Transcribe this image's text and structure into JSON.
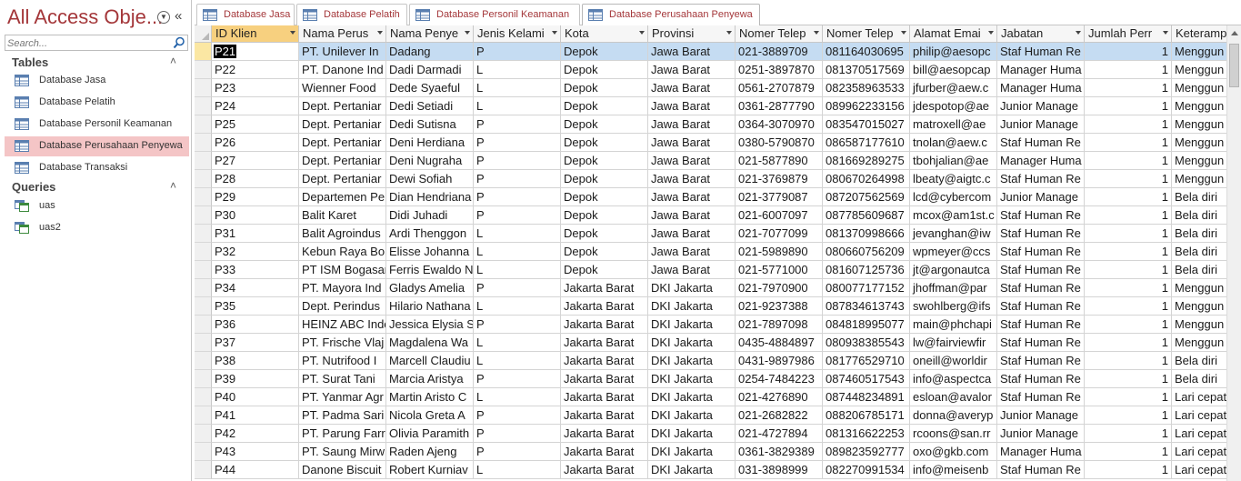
{
  "nav": {
    "title": "All Access Obje...",
    "search_placeholder": "Search...",
    "groups": [
      {
        "label": "Tables",
        "caret": "˄"
      },
      {
        "label": "Queries",
        "caret": "˄"
      }
    ],
    "tables": [
      "Database Jasa",
      "Database Pelatih",
      "Database Personil Keamanan",
      "Database Perusahaan Penyewa",
      "Database Transaksi"
    ],
    "queries": [
      "uas",
      "uas2"
    ],
    "active_table": "Database Perusahaan Penyewa"
  },
  "tabs": [
    "Database Jasa",
    "Database Pelatih",
    "Database Personil Keamanan",
    "Database Perusahaan Penyewa"
  ],
  "active_tab": "Database Perusahaan Penyewa",
  "columns": [
    "ID Klien",
    "Nama Perus",
    "Nama Penye",
    "Jenis Kelami",
    "Kota",
    "Provinsi",
    "Nomer Telep",
    "Nomer Telep",
    "Alamat Emai",
    "Jabatan",
    "Jumlah Perr",
    "Keteramp"
  ],
  "sorted_column": "ID Klien",
  "rows": [
    [
      "P21",
      "PT. Unilever In",
      "Dadang",
      "P",
      "Depok",
      "Jawa Barat",
      "021-3889709",
      "081164030695",
      "philip@aesopc",
      "Staf Human Re",
      "1",
      "Menggun"
    ],
    [
      "P22",
      "PT. Danone Ind",
      "Dadi Darmadi",
      "L",
      "Depok",
      "Jawa Barat",
      "0251-3897870",
      "081370517569",
      "bill@aesopcap",
      "Manager Huma",
      "1",
      "Menggun"
    ],
    [
      "P23",
      "Wienner Food",
      "Dede Syaeful",
      "L",
      "Depok",
      "Jawa Barat",
      "0561-2707879",
      "082358963533",
      "jfurber@aew.c",
      "Manager Huma",
      "1",
      "Menggun"
    ],
    [
      "P24",
      "Dept. Pertaniar",
      "Dedi Setiadi",
      "L",
      "Depok",
      "Jawa Barat",
      "0361-2877790",
      "089962233156",
      "jdespotop@ae",
      "Junior Manage",
      "1",
      "Menggun"
    ],
    [
      "P25",
      "Dept. Pertaniar",
      "Dedi Sutisna",
      "P",
      "Depok",
      "Jawa Barat",
      "0364-3070970",
      "083547015027",
      "matroxell@ae",
      "Junior Manage",
      "1",
      "Menggun"
    ],
    [
      "P26",
      "Dept. Pertaniar",
      "Deni Herdiana",
      "P",
      "Depok",
      "Jawa Barat",
      "0380-5790870",
      "086587177610",
      "tnolan@aew.c",
      "Staf Human Re",
      "1",
      "Menggun"
    ],
    [
      "P27",
      "Dept. Pertaniar",
      "Deni Nugraha",
      "P",
      "Depok",
      "Jawa Barat",
      "021-5877890",
      "081669289275",
      "tbohjalian@ae",
      "Manager Huma",
      "1",
      "Menggun"
    ],
    [
      "P28",
      "Dept. Pertaniar",
      "Dewi Sofiah",
      "P",
      "Depok",
      "Jawa Barat",
      "021-3769879",
      "080670264998",
      "lbeaty@aigtc.c",
      "Staf Human Re",
      "1",
      "Menggun"
    ],
    [
      "P29",
      "Departemen Pe",
      "Dian Hendriana",
      "P",
      "Depok",
      "Jawa Barat",
      "021-3779087",
      "087207562569",
      "lcd@cybercom",
      "Junior Manage",
      "1",
      "Bela diri"
    ],
    [
      "P30",
      "Balit Karet",
      "Didi Juhadi",
      "P",
      "Depok",
      "Jawa Barat",
      "021-6007097",
      "087785609687",
      "mcox@am1st.c",
      "Staf Human Re",
      "1",
      "Bela diri"
    ],
    [
      "P31",
      "Balit Agroindus",
      "Ardi Thenggon",
      "L",
      "Depok",
      "Jawa Barat",
      "021-7077099",
      "081370998666",
      "jevanghan@iw",
      "Staf Human Re",
      "1",
      "Bela diri"
    ],
    [
      "P32",
      "Kebun Raya Bo",
      "Elisse Johanna",
      "L",
      "Depok",
      "Jawa Barat",
      "021-5989890",
      "080660756209",
      "wpmeyer@ccs",
      "Staf Human Re",
      "1",
      "Bela diri"
    ],
    [
      "P33",
      "PT ISM Bogasar",
      "Ferris Ewaldo N",
      "L",
      "Depok",
      "Jawa Barat",
      "021-5771000",
      "081607125736",
      "jt@argonautca",
      "Staf Human Re",
      "1",
      "Bela diri"
    ],
    [
      "P34",
      "PT. Mayora Ind",
      "Gladys Amelia",
      "P",
      "Jakarta Barat",
      "DKI Jakarta",
      "021-7970900",
      "080077177152",
      "jhoffman@par",
      "Staf Human Re",
      "1",
      "Menggun"
    ],
    [
      "P35",
      "Dept. Perindus",
      "Hilario Nathana",
      "L",
      "Jakarta Barat",
      "DKI Jakarta",
      "021-9237388",
      "087834613743",
      "swohlberg@ifs",
      "Staf Human Re",
      "1",
      "Menggun"
    ],
    [
      "P36",
      "HEINZ ABC Indo",
      "Jessica Elysia S",
      "P",
      "Jakarta Barat",
      "DKI Jakarta",
      "021-7897098",
      "084818995077",
      "main@phchapi",
      "Staf Human Re",
      "1",
      "Menggun"
    ],
    [
      "P37",
      "PT. Frische Vlaj",
      "Magdalena Wa",
      "L",
      "Jakarta Barat",
      "DKI Jakarta",
      "0435-4884897",
      "080938385543",
      "lw@fairviewfir",
      "Staf Human Re",
      "1",
      "Menggun"
    ],
    [
      "P38",
      "PT. Nutrifood I",
      "Marcell Claudiu",
      "L",
      "Jakarta Barat",
      "DKI Jakarta",
      "0431-9897986",
      "081776529710",
      "oneill@worldir",
      "Staf Human Re",
      "1",
      "Bela diri"
    ],
    [
      "P39",
      "PT. Surat Tani",
      "Marcia Aristya",
      "P",
      "Jakarta Barat",
      "DKI Jakarta",
      "0254-7484223",
      "087460517543",
      "info@aspectca",
      "Staf Human Re",
      "1",
      "Bela diri"
    ],
    [
      "P40",
      "PT. Yanmar Agr",
      "Martin Aristo C",
      "L",
      "Jakarta Barat",
      "DKI Jakarta",
      "021-4276890",
      "087448234891",
      "esloan@avalor",
      "Staf Human Re",
      "1",
      "Lari cepat"
    ],
    [
      "P41",
      "PT. Padma Sari",
      "Nicola Greta A",
      "P",
      "Jakarta Barat",
      "DKI Jakarta",
      "021-2682822",
      "088206785171",
      "donna@averyp",
      "Junior Manage",
      "1",
      "Lari cepat"
    ],
    [
      "P42",
      "PT. Parung Farr",
      "Olivia Paramith",
      "P",
      "Jakarta Barat",
      "DKI Jakarta",
      "021-4727894",
      "081316622253",
      "rcoons@san.rr",
      "Junior Manage",
      "1",
      "Lari cepat"
    ],
    [
      "P43",
      "PT. Saung Mirw",
      "Raden Ajeng",
      "P",
      "Jakarta Barat",
      "DKI Jakarta",
      "0361-3829389",
      "089823592777",
      "oxo@gkb.com",
      "Manager Huma",
      "1",
      "Lari cepat"
    ],
    [
      "P44",
      "Danone Biscuit",
      "Robert Kurniav",
      "L",
      "Jakarta Barat",
      "DKI Jakarta",
      "031-3898999",
      "082270991534",
      "info@meisenb",
      "Staf Human Re",
      "1",
      "Lari cepat"
    ]
  ],
  "colors": {
    "accent": "#a4373a",
    "active_nav": "#f4c5c6",
    "sorted_header": "#f7d07f",
    "selected_row": "#c5dcf2"
  }
}
